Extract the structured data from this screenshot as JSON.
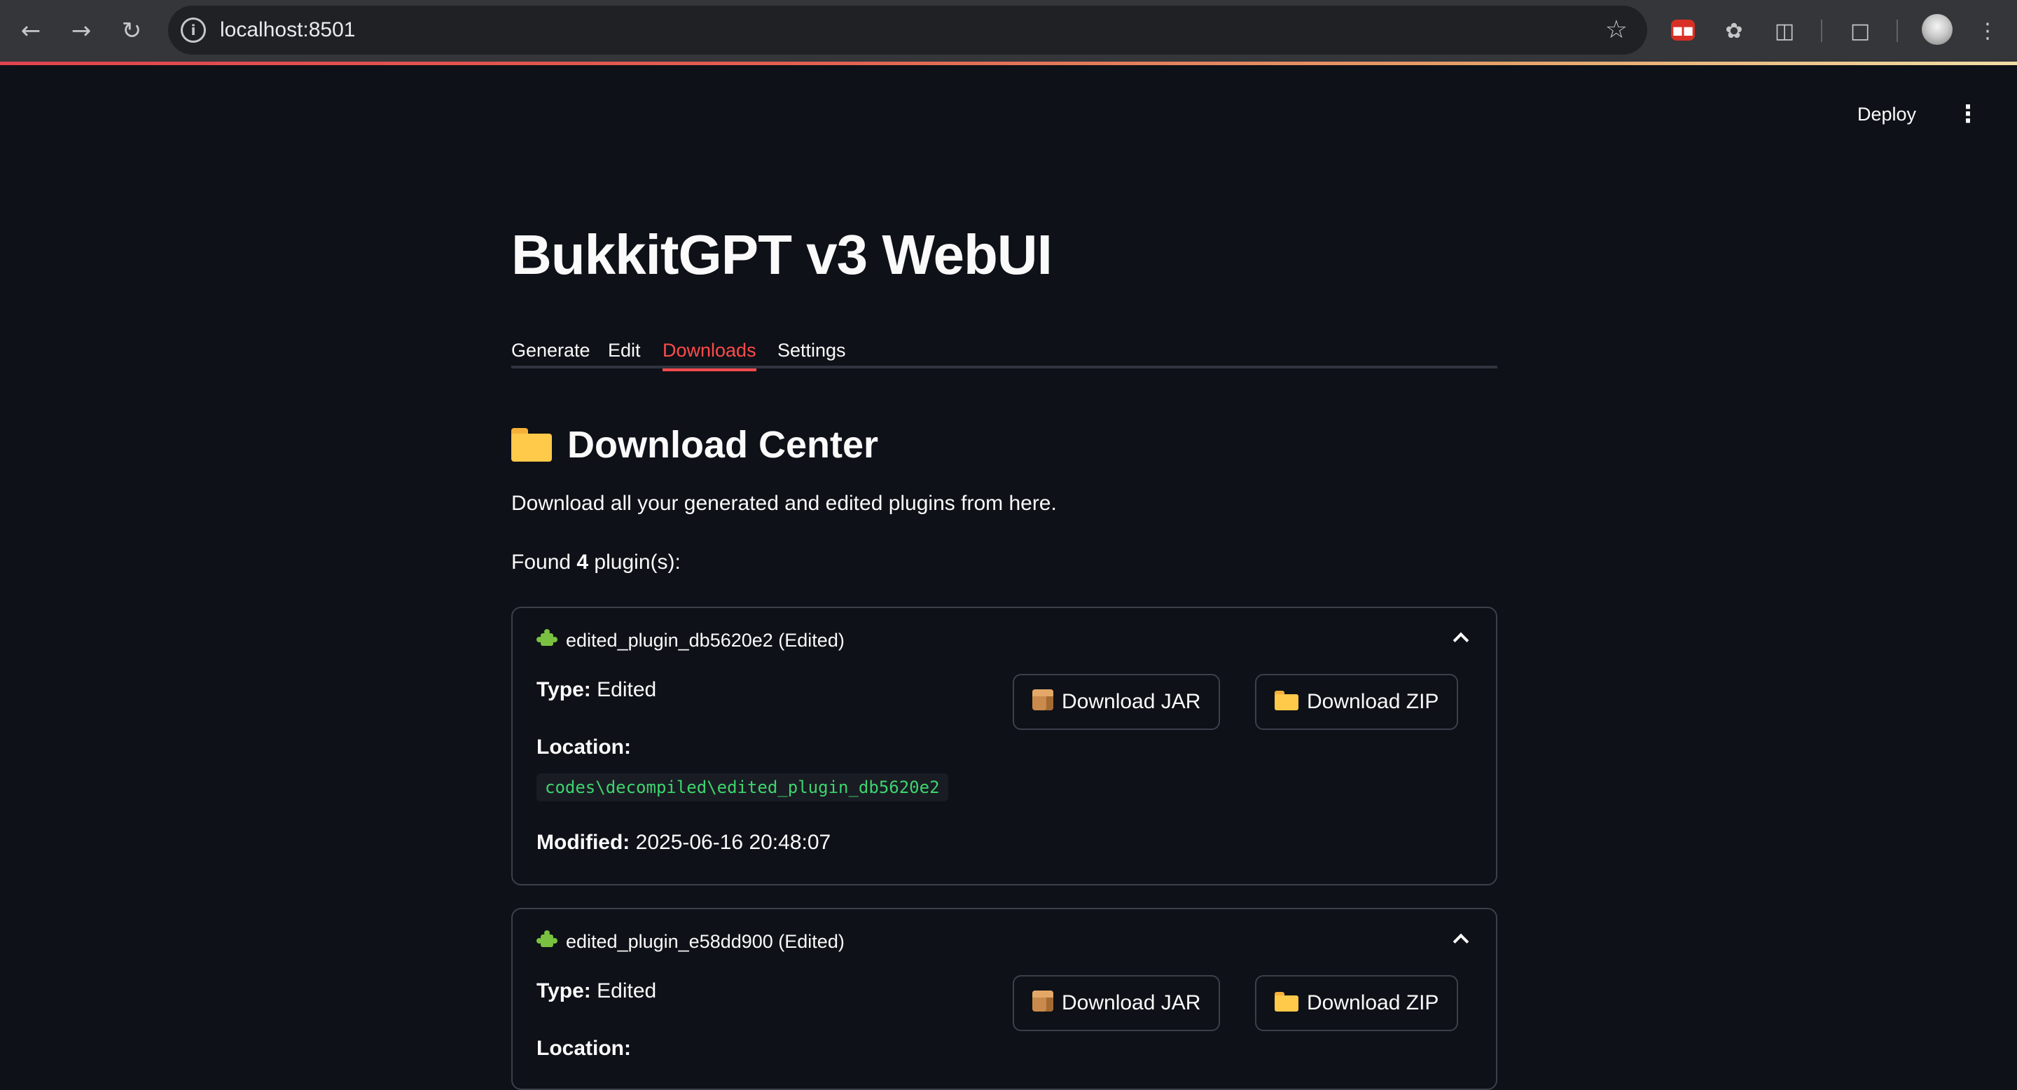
{
  "browser": {
    "url": "localhost:8501"
  },
  "app": {
    "deploy_label": "Deploy",
    "title": "BukkitGPT v3 WebUI",
    "tabs": [
      {
        "label": "Generate",
        "active": false
      },
      {
        "label": "Edit",
        "active": false
      },
      {
        "label": "Downloads",
        "active": true
      },
      {
        "label": "Settings",
        "active": false
      }
    ],
    "accent_color": "#ff4b4b"
  },
  "download_center": {
    "title": "Download Center",
    "title_icon": "folder-icon",
    "description": "Download all your generated and edited plugins from here.",
    "found_prefix": "Found ",
    "found_count": "4",
    "found_suffix": " plugin(s):"
  },
  "plugins": [
    {
      "header": "edited_plugin_db5620e2 (Edited)",
      "header_icon": "puzzle-icon",
      "type_label": "Type:",
      "type_value": " Edited",
      "location_label": "Location:",
      "location_value": "codes\\decompiled\\edited_plugin_db5620e2",
      "modified_label": "Modified:",
      "modified_value": " 2025-06-16 20:48:07",
      "jar_button": "Download JAR",
      "zip_button": "Download ZIP"
    },
    {
      "header": "edited_plugin_e58dd900 (Edited)",
      "header_icon": "puzzle-icon",
      "type_label": "Type:",
      "type_value": " Edited",
      "location_label": "Location:",
      "jar_button": "Download JAR",
      "zip_button": "Download ZIP"
    }
  ]
}
